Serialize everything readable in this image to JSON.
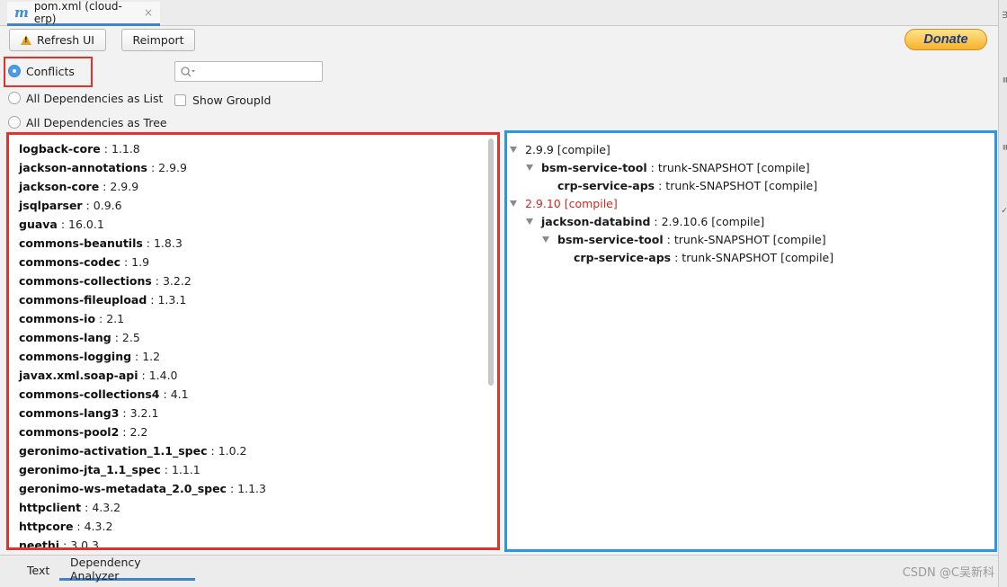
{
  "tab": {
    "icon": "maven-m-icon",
    "title": "pom.xml (cloud-erp)",
    "close": "×"
  },
  "toolbar": {
    "refresh_label": "Refresh UI",
    "reimport_label": "Reimport",
    "donate_label": "Donate"
  },
  "options": {
    "conflicts": "Conflicts",
    "list": "All Dependencies as List",
    "tree": "All Dependencies as Tree",
    "selected": "Conflicts",
    "show_groupid": "Show GroupId",
    "show_groupid_checked": false
  },
  "search": {
    "value": "",
    "placeholder": ""
  },
  "dependencies": [
    {
      "name": "logback-core",
      "version": "1.1.8"
    },
    {
      "name": "jackson-annotations",
      "version": "2.9.9"
    },
    {
      "name": "jackson-core",
      "version": "2.9.9"
    },
    {
      "name": "jsqlparser",
      "version": "0.9.6"
    },
    {
      "name": "guava",
      "version": "16.0.1"
    },
    {
      "name": "commons-beanutils",
      "version": "1.8.3"
    },
    {
      "name": "commons-codec",
      "version": "1.9"
    },
    {
      "name": "commons-collections",
      "version": "3.2.2"
    },
    {
      "name": "commons-fileupload",
      "version": "1.3.1"
    },
    {
      "name": "commons-io",
      "version": "2.1"
    },
    {
      "name": "commons-lang",
      "version": "2.5"
    },
    {
      "name": "commons-logging",
      "version": "1.2"
    },
    {
      "name": "javax.xml.soap-api",
      "version": "1.4.0"
    },
    {
      "name": "commons-collections4",
      "version": "4.1"
    },
    {
      "name": "commons-lang3",
      "version": "3.2.1"
    },
    {
      "name": "commons-pool2",
      "version": "2.2"
    },
    {
      "name": "geronimo-activation_1.1_spec",
      "version": "1.0.2"
    },
    {
      "name": "geronimo-jta_1.1_spec",
      "version": "1.1.1"
    },
    {
      "name": "geronimo-ws-metadata_2.0_spec",
      "version": "1.1.3"
    },
    {
      "name": "httpclient",
      "version": "4.3.2"
    },
    {
      "name": "httpcore",
      "version": "4.3.2"
    },
    {
      "name": "neethi",
      "version": "3.0.3"
    }
  ],
  "tree": [
    {
      "level": 0,
      "expanded": true,
      "name": "",
      "text": "2.9.9 [compile]",
      "conflict": false
    },
    {
      "level": 1,
      "expanded": true,
      "name": "bsm-service-tool",
      "text": "trunk-SNAPSHOT [compile]",
      "conflict": false
    },
    {
      "level": 2,
      "expanded": false,
      "name": "crp-service-aps",
      "text": "trunk-SNAPSHOT [compile]",
      "conflict": false
    },
    {
      "level": 0,
      "expanded": true,
      "name": "",
      "text": "2.9.10 [compile]",
      "conflict": true
    },
    {
      "level": 1,
      "expanded": true,
      "name": "jackson-databind",
      "text": "2.9.10.6 [compile]",
      "conflict": false
    },
    {
      "level": 2,
      "expanded": true,
      "name": "bsm-service-tool",
      "text": "trunk-SNAPSHOT [compile]",
      "conflict": false
    },
    {
      "level": 3,
      "expanded": false,
      "name": "crp-service-aps",
      "text": "trunk-SNAPSHOT [compile]",
      "conflict": false
    }
  ],
  "bottom_tabs": [
    {
      "label": "Text",
      "active": false
    },
    {
      "label": "Dependency Analyzer",
      "active": true
    }
  ],
  "watermark": "CSDN @C吴新科",
  "colors": {
    "accent": "#4083c9",
    "conflict_red": "#d0281f",
    "highlight_red": "#e0332d",
    "highlight_blue": "#2a97e3"
  }
}
